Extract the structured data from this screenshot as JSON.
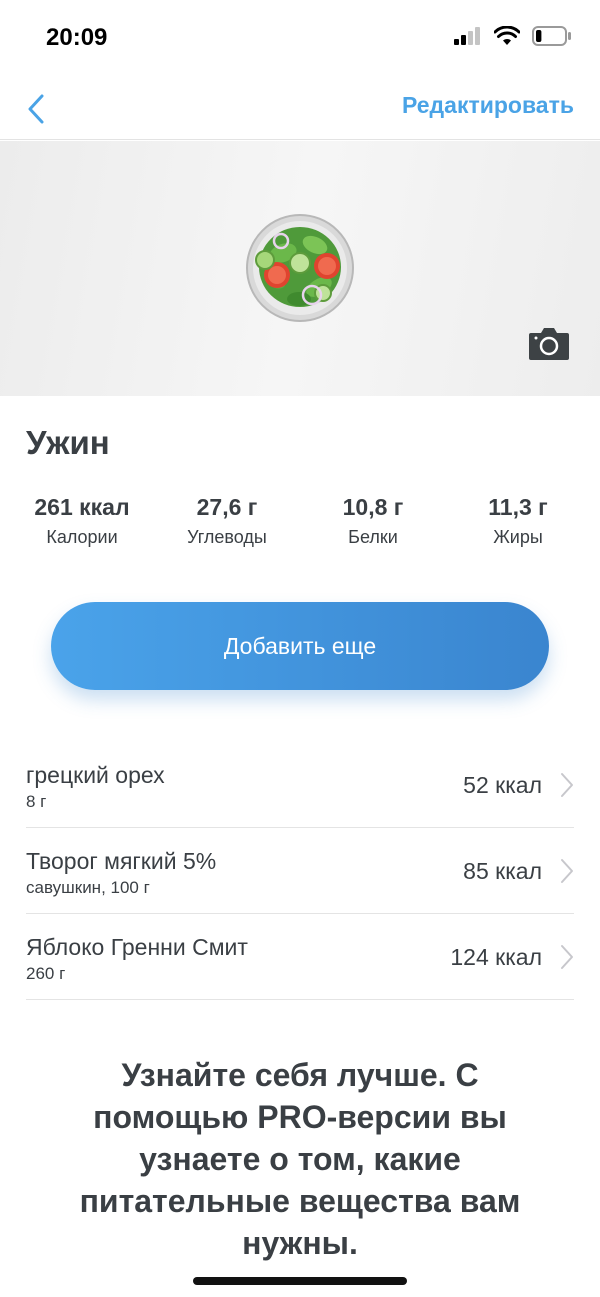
{
  "status": {
    "time": "20:09",
    "signal_icon": "cellular-signal-icon",
    "wifi_icon": "wifi-icon",
    "battery_icon": "battery-icon",
    "battery_level": 0.2
  },
  "nav": {
    "back_icon": "chevron-left-icon",
    "edit_label": "Редактировать"
  },
  "photo": {
    "image_icon": "salad-bowl-icon",
    "camera_icon": "camera-icon"
  },
  "meal": {
    "title": "Ужин",
    "nutrients": [
      {
        "value": "261 ккал",
        "label": "Калории"
      },
      {
        "value": "27,6 г",
        "label": "Углеводы"
      },
      {
        "value": "10,8 г",
        "label": "Белки"
      },
      {
        "value": "11,3 г",
        "label": "Жиры"
      }
    ],
    "add_label": "Добавить еще"
  },
  "foods": [
    {
      "name": "грецкий орех",
      "portion": "8 г",
      "kcal": "52 ккал"
    },
    {
      "name": "Творог мягкий 5%",
      "portion": "савушкин, 100 г",
      "kcal": "85 ккал"
    },
    {
      "name": "Яблоко Гренни Смит",
      "portion": "260 г",
      "kcal": "124 ккал"
    }
  ],
  "promo": {
    "text": "Узнайте себя лучше. С помощью PRO-версии вы узнаете о том, какие питательные вещества вам нужны."
  },
  "colors": {
    "accent": "#4aa3e6",
    "button_start": "#4aa3ea",
    "button_end": "#3a85cf",
    "text": "#3a3f44"
  }
}
